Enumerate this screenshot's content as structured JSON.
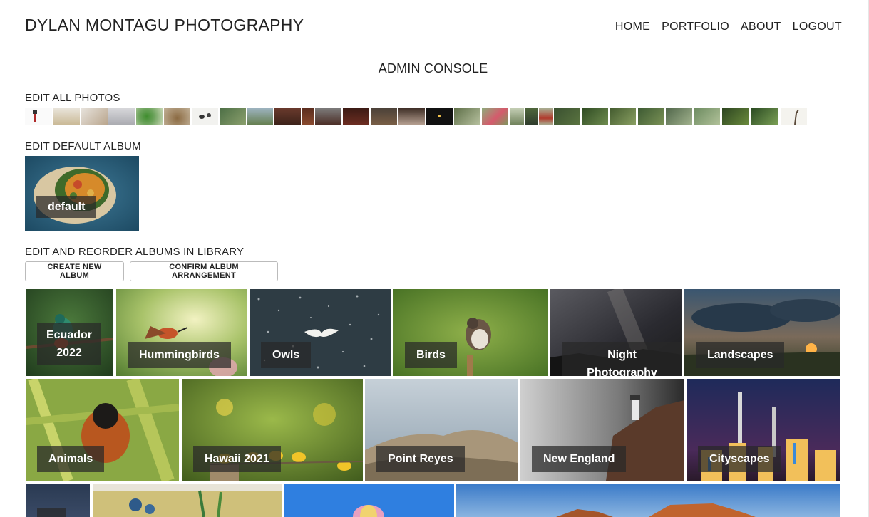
{
  "header": {
    "site_title": "DYLAN MONTAGU PHOTOGRAPHY",
    "nav": [
      "HOME",
      "PORTFOLIO",
      "ABOUT",
      "LOGOUT"
    ]
  },
  "console_title": "ADMIN CONSOLE",
  "sections": {
    "all_photos": "EDIT ALL PHOTOS",
    "default_album": "EDIT DEFAULT ALBUM",
    "library": "EDIT AND REORDER ALBUMS IN LIBRARY"
  },
  "default_album": {
    "label": "default"
  },
  "buttons": {
    "create": "CREATE NEW ALBUM",
    "confirm": "CONFIRM ALBUM ARRANGEMENT"
  },
  "albums": [
    {
      "label": "Ecuador 2022"
    },
    {
      "label": "Hummingbirds"
    },
    {
      "label": "Owls"
    },
    {
      "label": "Birds"
    },
    {
      "label": "Night Photography"
    },
    {
      "label": "Landscapes"
    },
    {
      "label": "Animals"
    },
    {
      "label": "Hawaii 2021"
    },
    {
      "label": "Point Reyes"
    },
    {
      "label": "New England"
    },
    {
      "label": "Cityscapes"
    }
  ],
  "colors": {
    "label_bg": "#2e2e2e",
    "text": "#222222"
  }
}
